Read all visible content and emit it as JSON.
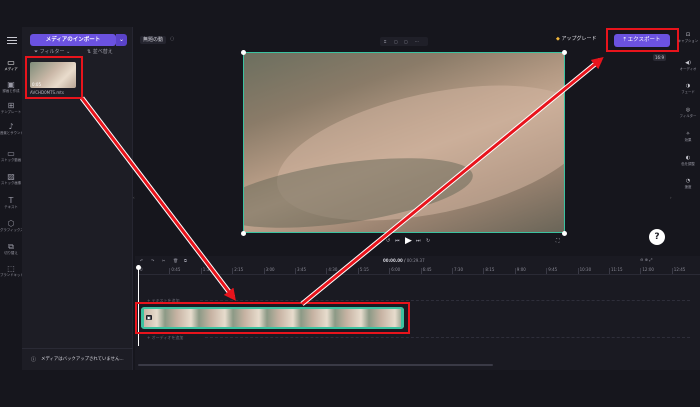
{
  "rail": {
    "items": [
      {
        "label": "メディア",
        "icon": "folder"
      },
      {
        "label": "録画と作成",
        "icon": "camera"
      },
      {
        "label": "テンプレート",
        "icon": "grid"
      },
      {
        "label": "音楽とサウンドエフェクト",
        "icon": "music"
      },
      {
        "label": "ストック動画",
        "icon": "film"
      },
      {
        "label": "ストック画像",
        "icon": "image"
      },
      {
        "label": "テキスト",
        "icon": "T"
      },
      {
        "label": "グラフィックス",
        "icon": "shapes"
      },
      {
        "label": "切り替え",
        "icon": "transition"
      },
      {
        "label": "ブランドキット",
        "icon": "brand"
      }
    ]
  },
  "media": {
    "import_label": "メディアのインポート",
    "filter_label": "フィルター",
    "sort_label": "並べ替え",
    "clip_duration": "0:05",
    "clip_name": "AVCHD0MTS.mts",
    "backup_notice": "メディアはバックアップされていません..."
  },
  "header": {
    "project_name": "無題の動",
    "upgrade_label": "アップグレード",
    "export_label": "エクスポート",
    "aspect_ratio": "16:9"
  },
  "right_panel": {
    "items": [
      {
        "label": "キャプション",
        "icon": "cc"
      },
      {
        "label": "オーディオ",
        "icon": "speaker"
      },
      {
        "label": "フェード",
        "icon": "fade"
      },
      {
        "label": "フィルター",
        "icon": "filter"
      },
      {
        "label": "効果",
        "icon": "magic"
      },
      {
        "label": "色を調整",
        "icon": "contrast"
      },
      {
        "label": "速度",
        "icon": "gauge"
      }
    ]
  },
  "timeline": {
    "current_time": "00:00.00",
    "total_time": "00:29.37",
    "ruler_labels": [
      "0",
      "0:45",
      "1:30",
      "2:15",
      "3:00",
      "3:45",
      "4:30",
      "5:15",
      "6:00",
      "6:45",
      "7:30",
      "8:15",
      "9:00",
      "9:45",
      "10:30",
      "11:15",
      "12:00",
      "12:45"
    ],
    "text_track_hint": "+ テキストを追加",
    "audio_track_hint": "+ オーディオを追加"
  },
  "colors": {
    "accent": "#6b52e0",
    "highlight": "#e8141c",
    "clip_border": "#3bc2a0"
  }
}
